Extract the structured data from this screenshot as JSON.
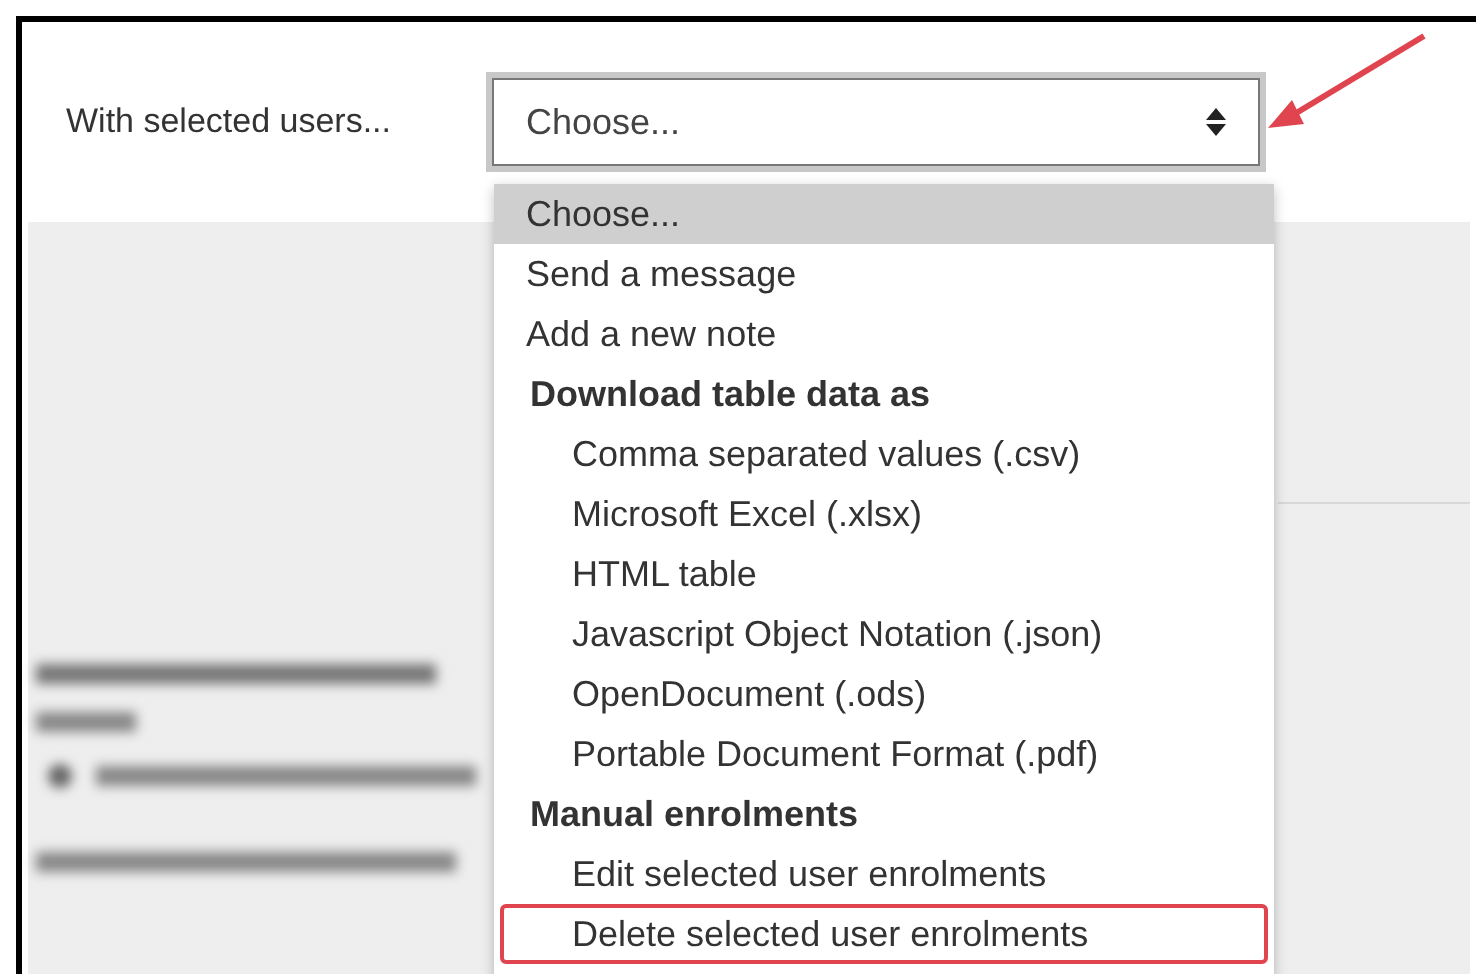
{
  "action": {
    "label": "With selected users...",
    "select": {
      "value": "Choose..."
    }
  },
  "options": [
    {
      "kind": "option",
      "label": "Choose...",
      "selected": true,
      "highlighted": false
    },
    {
      "kind": "option",
      "label": "Send a message",
      "selected": false,
      "highlighted": false
    },
    {
      "kind": "option",
      "label": "Add a new note",
      "selected": false,
      "highlighted": false
    },
    {
      "kind": "group",
      "label": "Download table data as",
      "children": [
        {
          "label": "Comma separated values (.csv)",
          "selected": false,
          "highlighted": false
        },
        {
          "label": "Microsoft Excel (.xlsx)",
          "selected": false,
          "highlighted": false
        },
        {
          "label": "HTML table",
          "selected": false,
          "highlighted": false
        },
        {
          "label": "Javascript Object Notation (.json)",
          "selected": false,
          "highlighted": false
        },
        {
          "label": "OpenDocument (.ods)",
          "selected": false,
          "highlighted": false
        },
        {
          "label": "Portable Document Format (.pdf)",
          "selected": false,
          "highlighted": false
        }
      ]
    },
    {
      "kind": "group",
      "label": "Manual enrolments",
      "children": [
        {
          "label": "Edit selected user enrolments",
          "selected": false,
          "highlighted": false
        },
        {
          "label": "Delete selected user enrolments",
          "selected": false,
          "highlighted": true
        }
      ]
    }
  ]
}
